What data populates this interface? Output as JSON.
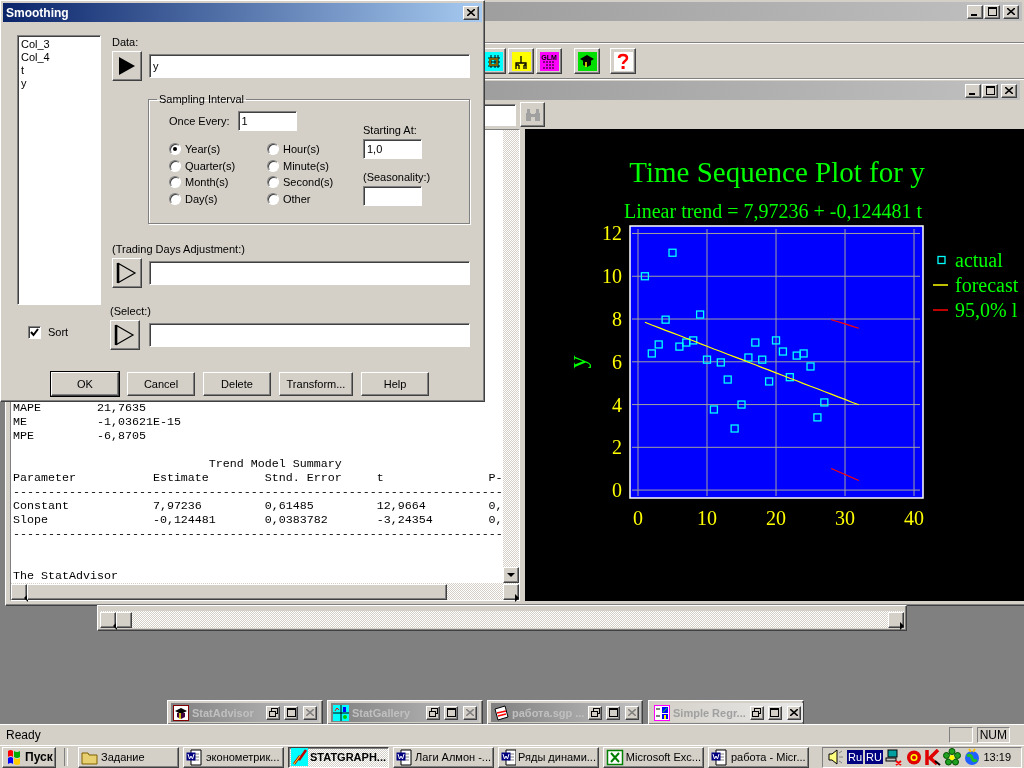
{
  "main_window": {
    "toolbar": [
      {
        "kind": "grid"
      },
      {
        "kind": "tree"
      },
      {
        "kind": "glm",
        "label": "GLM"
      },
      {
        "kind": "advisor"
      },
      {
        "kind": "help"
      }
    ]
  },
  "analysis_window": {
    "output": {
      "stats": [
        {
          "name": "MAPE",
          "value": "21,7635"
        },
        {
          "name": "ME",
          "value": "-1,03621E-15"
        },
        {
          "name": "MPE",
          "value": "-6,8705"
        }
      ],
      "table": {
        "title": "Trend Model Summary",
        "columns": [
          "Parameter",
          "Estimate",
          "Stnd. Error",
          "t",
          "P-"
        ],
        "rule_top": "----------------------------------------------------------------------",
        "rows": [
          [
            "Constant",
            "7,97236",
            "0,61485",
            "12,9664",
            "0,"
          ],
          [
            "Slope",
            "-0,124481",
            "0,0383782",
            "-3,24354",
            "0,"
          ]
        ],
        "rule_bottom": "----------------------------------------------------------------------"
      },
      "advisor": "The StatAdvisor"
    },
    "chart_data": {
      "type": "scatter",
      "title": "Time Sequence Plot for y",
      "subtitle": "Linear trend = 7,97236 + -0,124481 t",
      "ylabel": "y",
      "xlim": [
        -1.16,
        41.3
      ],
      "ylim": [
        -0.37,
        12.35
      ],
      "xticks": [
        0,
        10,
        20,
        30,
        40
      ],
      "yticks": [
        0,
        2,
        4,
        6,
        8,
        10,
        12
      ],
      "grid": true,
      "legend": true,
      "x": [
        1,
        2,
        3,
        4,
        5,
        6,
        7,
        8,
        9,
        10,
        11,
        12,
        13,
        14,
        15,
        16,
        17,
        18,
        19,
        20,
        21,
        22,
        23,
        24,
        25,
        26,
        27,
        28,
        29,
        30,
        31,
        32
      ],
      "series": [
        {
          "name": "actual",
          "type": "scatter",
          "color": "#00ffff",
          "values": [
            10.0,
            6.39,
            6.81,
            7.97,
            11.1,
            6.71,
            6.9,
            7.0,
            8.21,
            6.1,
            3.77,
            5.97,
            5.17,
            2.88,
            4.0,
            6.2,
            6.9,
            6.1,
            5.08,
            7.0,
            6.48,
            5.28,
            6.29,
            6.39,
            5.78,
            3.4,
            4.1,
            null,
            null,
            null,
            null,
            null
          ]
        },
        {
          "name": "forecast",
          "type": "line",
          "color": "#ffff00",
          "values": [
            7.85,
            7.72,
            7.6,
            7.47,
            7.35,
            7.23,
            7.1,
            6.98,
            6.85,
            6.73,
            6.6,
            6.48,
            6.35,
            6.23,
            6.11,
            5.98,
            5.86,
            5.73,
            5.61,
            5.48,
            5.36,
            5.23,
            5.11,
            4.98,
            4.86,
            4.74,
            4.61,
            4.49,
            4.36,
            4.24,
            4.11,
            3.99
          ]
        },
        {
          "name": "95,0% l",
          "type": "line",
          "color": "#ff0000",
          "values": [
            null,
            null,
            null,
            null,
            null,
            null,
            null,
            null,
            null,
            null,
            null,
            null,
            null,
            null,
            null,
            null,
            null,
            null,
            null,
            null,
            null,
            null,
            null,
            null,
            null,
            null,
            null,
            7.97,
            7.87,
            7.77,
            7.67,
            7.57
          ]
        },
        {
          "type": "line",
          "color": "#ff0000",
          "values": [
            null,
            null,
            null,
            null,
            null,
            null,
            null,
            null,
            null,
            null,
            null,
            null,
            null,
            null,
            null,
            null,
            null,
            null,
            null,
            null,
            null,
            null,
            null,
            null,
            null,
            null,
            null,
            1.01,
            0.87,
            0.73,
            0.59,
            0.45
          ]
        }
      ]
    }
  },
  "dialog": {
    "title": "Smoothing",
    "variables": [
      "Col_3",
      "Col_4",
      "t",
      "y"
    ],
    "sort": {
      "label": "Sort",
      "checked": true
    },
    "data": {
      "label": "Data:",
      "value": "y",
      "active": true
    },
    "sampling": {
      "title": "Sampling Interval",
      "once_every_label": "Once Every:",
      "once_every": "1",
      "units": [
        {
          "label": "Year(s)",
          "selected": true
        },
        {
          "label": "Quarter(s)",
          "selected": false
        },
        {
          "label": "Month(s)",
          "selected": false
        },
        {
          "label": "Day(s)",
          "selected": false
        },
        {
          "label": "Hour(s)",
          "selected": false
        },
        {
          "label": "Minute(s)",
          "selected": false
        },
        {
          "label": "Second(s)",
          "selected": false
        },
        {
          "label": "Other",
          "selected": false
        }
      ],
      "starting_at_label": "Starting At:",
      "starting_at": "1,0",
      "seasonality_label": "(Seasonality:)"
    },
    "trading_days": {
      "label": "(Trading Days Adjustment:)",
      "active": false
    },
    "select": {
      "label": "(Select:)",
      "active": false
    },
    "buttons": [
      "OK",
      "Cancel",
      "Delete",
      "Transform...",
      "Help"
    ]
  },
  "minimized_windows": [
    {
      "title": "StatAdvisor",
      "kind": "advisor",
      "active": false
    },
    {
      "title": "StatGallery",
      "kind": "gallery",
      "active": false
    },
    {
      "title": "работа.sgp ...",
      "kind": "notepad",
      "active": false
    },
    {
      "title": "Simple Regr...",
      "kind": "regression",
      "active": true
    }
  ],
  "status_bar": {
    "text": "Ready",
    "indicator": "NUM"
  },
  "taskbar": {
    "start": "Пуск",
    "tasks": [
      {
        "label": "Задание",
        "kind": "folder",
        "selected": false
      },
      {
        "label": "эконометрик...",
        "kind": "document",
        "selected": false
      },
      {
        "label": "STATGRAPH...",
        "kind": "graph",
        "selected": true
      },
      {
        "label": "Лаги Алмон -...",
        "kind": "document",
        "selected": false
      },
      {
        "label": "Ряды динами...",
        "kind": "document",
        "selected": false
      },
      {
        "label": "Microsoft Exc...",
        "kind": "spreadsheet",
        "selected": false
      },
      {
        "label": "работа - Micr...",
        "kind": "document",
        "selected": false
      }
    ],
    "tray": [
      {
        "kind": "speaker"
      },
      {
        "kind": "language",
        "label": "Ru"
      },
      {
        "kind": "language",
        "label": "RU"
      },
      {
        "kind": "network"
      },
      {
        "kind": "ring"
      },
      {
        "kind": "k"
      },
      {
        "kind": "flower"
      },
      {
        "kind": "globe"
      }
    ],
    "clock": "13:19"
  }
}
